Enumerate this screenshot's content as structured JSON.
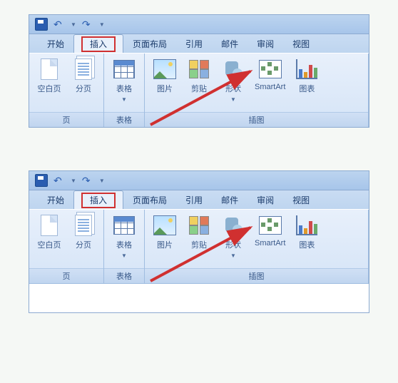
{
  "qat": {
    "save": "保存",
    "undo": "撤销",
    "redo": "重做"
  },
  "tabs": {
    "start": "开始",
    "insert": "插入",
    "pagelayout": "页面布局",
    "references": "引用",
    "mailings": "邮件",
    "review": "审阅",
    "view": "视图"
  },
  "groups": {
    "pages": {
      "label": "页",
      "blank": "空白页",
      "break": "分页"
    },
    "tables": {
      "label": "表格",
      "table": "表格"
    },
    "illustrations": {
      "label": "插图",
      "picture": "图片",
      "clipart": "剪贴画",
      "clipart_trunc": "剪贴",
      "shapes": "形状",
      "smartart": "SmartArt",
      "chart": "图表"
    }
  }
}
